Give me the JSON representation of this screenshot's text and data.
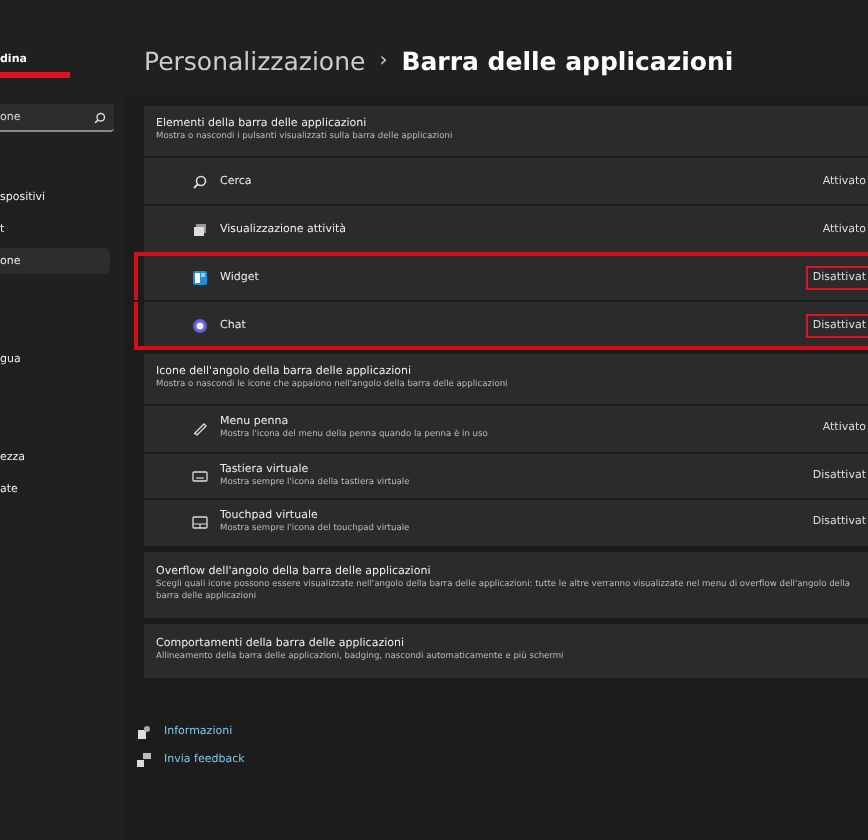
{
  "sidebar": {
    "user_name": "dina",
    "search": {
      "value": "one"
    },
    "items": [
      {
        "label": "spositivi",
        "selected": false
      },
      {
        "label": "t",
        "selected": false
      },
      {
        "label": "one",
        "selected": true
      },
      {
        "label": "gua",
        "selected": false
      },
      {
        "label": "ezza",
        "selected": false
      },
      {
        "label": "ate",
        "selected": false
      }
    ]
  },
  "breadcrumb": {
    "parent": "Personalizzazione",
    "separator": "›",
    "current": "Barra delle applicazioni"
  },
  "sections": [
    {
      "title": "Elementi della barra delle applicazioni",
      "subtitle": "Mostra o nascondi i pulsanti visualizzati sulla barra delle applicazioni",
      "rows": [
        {
          "label": "Cerca",
          "value": "Attivato",
          "highlighted": false
        },
        {
          "label": "Visualizzazione attività",
          "value": "Attivato",
          "highlighted": false
        },
        {
          "label": "Widget",
          "value": "Disattivat",
          "highlighted": true
        },
        {
          "label": "Chat",
          "value": "Disattivat",
          "highlighted": true
        }
      ]
    },
    {
      "title": "Icone dell'angolo della barra delle applicazioni",
      "subtitle": "Mostra o nascondi le icone che appaiono nell'angolo della barra delle applicazioni",
      "rows": [
        {
          "label": "Menu penna",
          "description": "Mostra l'icona del menu della penna quando la penna è in uso",
          "value": "Attivato",
          "highlighted": false
        },
        {
          "label": "Tastiera virtuale",
          "description": "Mostra sempre l'icona della tastiera virtuale",
          "value": "Disattivat",
          "highlighted": false
        },
        {
          "label": "Touchpad virtuale",
          "description": "Mostra sempre l'icona del touchpad virtuale",
          "value": "Disattivat",
          "highlighted": false
        }
      ]
    },
    {
      "title": "Overflow dell'angolo della barra delle applicazioni",
      "subtitle": "Scegli quali icone possono essere visualizzate nell'angolo della barra delle applicazioni: tutte le altre verranno visualizzate nel menu di overflow dell'angolo della barra delle applicazioni"
    },
    {
      "title": "Comportamenti della barra delle applicazioni",
      "subtitle": "Allineamento della barra delle applicazioni, badging, nascondi automaticamente e più schermi"
    }
  ],
  "links": [
    {
      "label": "Informazioni"
    },
    {
      "label": "Invia feedback"
    }
  ]
}
